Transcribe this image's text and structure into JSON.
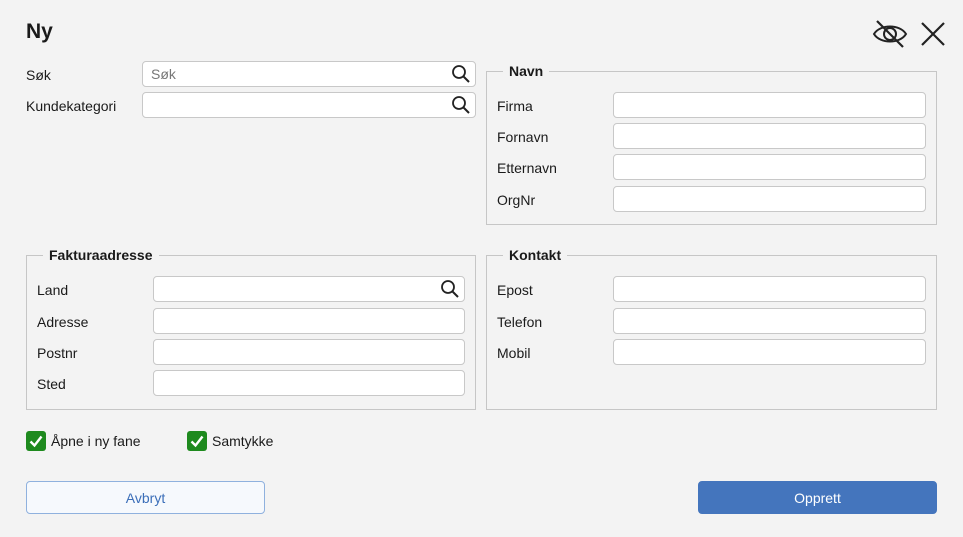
{
  "dialog": {
    "title": "Ny"
  },
  "header": {
    "hide_icon": "eye-off-icon",
    "close_icon": "close-icon"
  },
  "search": {
    "sok_label": "Søk",
    "sok_placeholder": "Søk",
    "sok_value": "",
    "kundekategori_label": "Kundekategori",
    "kundekategori_value": ""
  },
  "navn": {
    "legend": "Navn",
    "firma_label": "Firma",
    "firma_value": "",
    "fornavn_label": "Fornavn",
    "fornavn_value": "",
    "etternavn_label": "Etternavn",
    "etternavn_value": "",
    "orgnr_label": "OrgNr",
    "orgnr_value": ""
  },
  "faktura": {
    "legend": "Fakturaadresse",
    "land_label": "Land",
    "land_value": "",
    "adresse_label": "Adresse",
    "adresse_value": "",
    "postnr_label": "Postnr",
    "postnr_value": "",
    "sted_label": "Sted",
    "sted_value": ""
  },
  "kontakt": {
    "legend": "Kontakt",
    "epost_label": "Epost",
    "epost_value": "",
    "telefon_label": "Telefon",
    "telefon_value": "",
    "mobil_label": "Mobil",
    "mobil_value": ""
  },
  "options": {
    "apne_label": "Åpne i ny fane",
    "apne_checked": true,
    "samtykke_label": "Samtykke",
    "samtykke_checked": true
  },
  "buttons": {
    "cancel_label": "Avbryt",
    "create_label": "Opprett"
  },
  "colors": {
    "accent": "#4475bd",
    "checkbox": "#1e8a1e",
    "background": "#f3f3f3"
  }
}
